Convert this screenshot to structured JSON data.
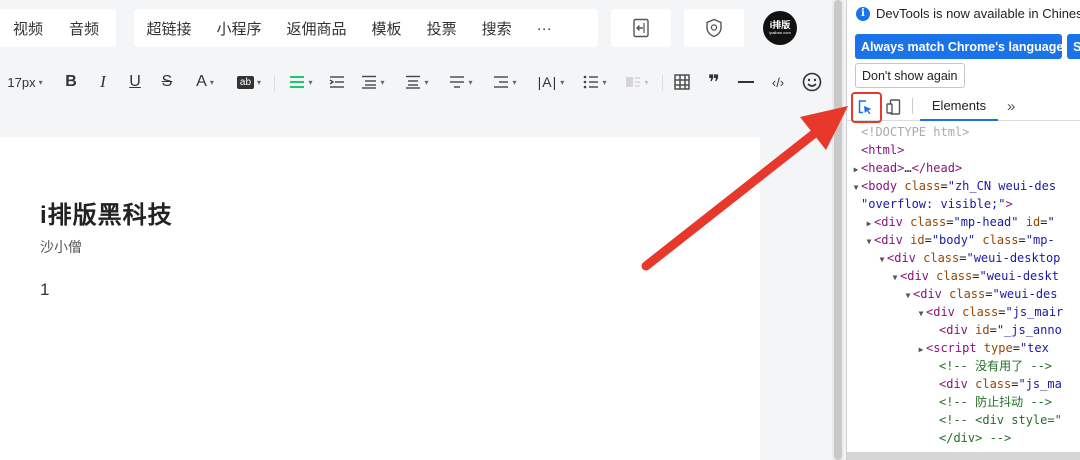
{
  "editor": {
    "insert_group_1": [
      "视频",
      "音频"
    ],
    "insert_group_2": [
      "超链接",
      "小程序",
      "返佣商品",
      "模板",
      "投票",
      "搜索",
      "···"
    ],
    "brand_logo_text": "i排版",
    "brand_logo_sub": "ipaiban.com",
    "format_toolbar": {
      "font_size": "17px",
      "bold": "B",
      "italic": "I",
      "underline": "U",
      "strikethrough": "S",
      "font_color": "A",
      "highlight": "ab",
      "quote": "❞",
      "code": "‹/›"
    },
    "document": {
      "title": "i排版黑科技",
      "author": "沙小僧",
      "body": "1"
    }
  },
  "devtools": {
    "notice": "DevTools is now available in Chinese",
    "btn_match_language": "Always match Chrome's language",
    "btn_switch": "S",
    "btn_dont_show": "Don't show again",
    "tab_elements": "Elements",
    "tab_more": "»",
    "dom_lines": [
      {
        "indent": 0,
        "tri": "",
        "parts": [
          [
            "t-doc",
            "<!DOCTYPE html>"
          ]
        ]
      },
      {
        "indent": 0,
        "tri": "",
        "parts": [
          [
            "t-tag",
            "<html>"
          ]
        ]
      },
      {
        "indent": 0,
        "tri": "▶",
        "parts": [
          [
            "t-tag",
            "<head>"
          ],
          [
            "t-txt",
            "…"
          ],
          [
            "t-tag",
            "</head>"
          ]
        ]
      },
      {
        "indent": 0,
        "tri": "▼",
        "parts": [
          [
            "t-tag",
            "<body "
          ],
          [
            "t-attr",
            "class"
          ],
          [
            "t-txt",
            "="
          ],
          [
            "t-val",
            "\"zh_CN weui-des"
          ]
        ]
      },
      {
        "indent": 0,
        "tri": "",
        "parts": [
          [
            "t-val",
            "\"overflow: visible;\""
          ],
          [
            "t-tag",
            ">"
          ]
        ]
      },
      {
        "indent": 1,
        "tri": "▶",
        "parts": [
          [
            "t-tag",
            "<div "
          ],
          [
            "t-attr",
            "class"
          ],
          [
            "t-txt",
            "="
          ],
          [
            "t-val",
            "\"mp-head\""
          ],
          [
            "t-txt",
            " "
          ],
          [
            "t-attr",
            "id"
          ],
          [
            "t-txt",
            "="
          ],
          [
            "t-val",
            "\""
          ]
        ]
      },
      {
        "indent": 1,
        "tri": "▼",
        "parts": [
          [
            "t-tag",
            "<div "
          ],
          [
            "t-attr",
            "id"
          ],
          [
            "t-txt",
            "="
          ],
          [
            "t-val",
            "\"body\""
          ],
          [
            "t-txt",
            " "
          ],
          [
            "t-attr",
            "class"
          ],
          [
            "t-txt",
            "="
          ],
          [
            "t-val",
            "\"mp-"
          ]
        ]
      },
      {
        "indent": 2,
        "tri": "▼",
        "parts": [
          [
            "t-tag",
            "<div "
          ],
          [
            "t-attr",
            "class"
          ],
          [
            "t-txt",
            "="
          ],
          [
            "t-val",
            "\"weui-desktop"
          ]
        ]
      },
      {
        "indent": 3,
        "tri": "▼",
        "parts": [
          [
            "t-tag",
            "<div "
          ],
          [
            "t-attr",
            "class"
          ],
          [
            "t-txt",
            "="
          ],
          [
            "t-val",
            "\"weui-deskt"
          ]
        ]
      },
      {
        "indent": 4,
        "tri": "▼",
        "parts": [
          [
            "t-tag",
            "<div "
          ],
          [
            "t-attr",
            "class"
          ],
          [
            "t-txt",
            "="
          ],
          [
            "t-val",
            "\"weui-des"
          ]
        ]
      },
      {
        "indent": 5,
        "tri": "▼",
        "parts": [
          [
            "t-tag",
            "<div "
          ],
          [
            "t-attr",
            "class"
          ],
          [
            "t-txt",
            "="
          ],
          [
            "t-val",
            "\"js_mair"
          ]
        ]
      },
      {
        "indent": 6,
        "tri": "",
        "parts": [
          [
            "t-tag",
            "<div "
          ],
          [
            "t-attr",
            "id"
          ],
          [
            "t-txt",
            "="
          ],
          [
            "t-val",
            "\"_js_anno"
          ]
        ]
      },
      {
        "indent": 5,
        "tri": "▶",
        "parts": [
          [
            "t-tag",
            "<script "
          ],
          [
            "t-attr",
            "type"
          ],
          [
            "t-txt",
            "="
          ],
          [
            "t-val",
            "\"tex"
          ]
        ]
      },
      {
        "indent": 6,
        "tri": "",
        "parts": [
          [
            "t-com",
            "<!-- 没有用了 -->"
          ]
        ]
      },
      {
        "indent": 6,
        "tri": "",
        "parts": [
          [
            "t-tag",
            "<div "
          ],
          [
            "t-attr",
            "class"
          ],
          [
            "t-txt",
            "="
          ],
          [
            "t-val",
            "\"js_ma"
          ]
        ]
      },
      {
        "indent": 6,
        "tri": "",
        "parts": [
          [
            "t-com",
            "<!-- 防止抖动 -->"
          ]
        ]
      },
      {
        "indent": 6,
        "tri": "",
        "parts": [
          [
            "t-com",
            "<!-- <div style=\""
          ]
        ]
      },
      {
        "indent": 6,
        "tri": "",
        "parts": [
          [
            "t-com",
            "</div> -->"
          ]
        ]
      }
    ]
  },
  "colors": {
    "devtools_blue": "#1a73e8",
    "arrow_red": "#e8372b",
    "green_align": "#07c160"
  }
}
